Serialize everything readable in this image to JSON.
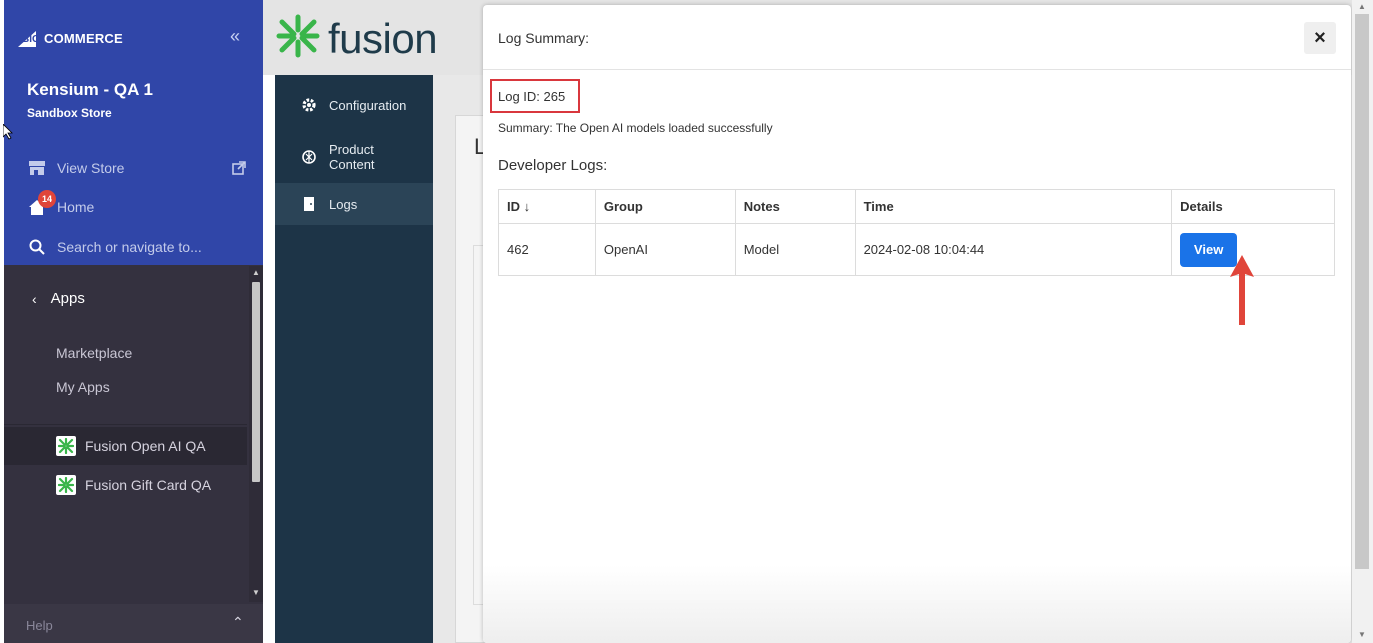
{
  "bigcommerce": {
    "brand": "BIGCOMMERCE",
    "brand_big": "BIG",
    "brand_rest": "COMMERCE",
    "store_name": "Kensium - QA 1",
    "store_type": "Sandbox Store",
    "nav": {
      "view_store": "View Store",
      "home": "Home",
      "home_badge": "14",
      "search_placeholder": "Search or navigate to..."
    },
    "apps": {
      "title": "Apps",
      "marketplace": "Marketplace",
      "my_apps": "My Apps",
      "installed": [
        {
          "label": "Fusion Open AI QA",
          "active": true
        },
        {
          "label": "Fusion Gift Card QA",
          "active": false
        }
      ]
    },
    "help": "Help"
  },
  "fusion": {
    "logo_text": "fusion",
    "nav": [
      {
        "label": "Configuration",
        "icon": "gear-icon"
      },
      {
        "label": "Product Content",
        "line1": "Product",
        "line2": "Content",
        "icon": "openai-icon"
      },
      {
        "label": "Logs",
        "icon": "door-icon",
        "active": true
      }
    ],
    "background_heading_initial": "L"
  },
  "modal": {
    "title": "Log Summary:",
    "log_id": "Log ID: 265",
    "summary": "Summary: The Open AI models loaded successfully",
    "developer_logs_title": "Developer Logs:",
    "table": {
      "columns": [
        "ID ↓",
        "Group",
        "Notes",
        "Time",
        "Details"
      ],
      "rows": [
        {
          "id": "462",
          "group": "OpenAI",
          "notes": "Model",
          "time": "2024-02-08 10:04:44",
          "details": "View"
        }
      ]
    },
    "close": "×"
  },
  "colors": {
    "bc_blue": "#3046a8",
    "bc_dark": "#34313f",
    "fusion_nav": "#1d3447",
    "fusion_green": "#39b54a",
    "highlight_red": "#d9373d",
    "button_blue": "#1a73e8"
  }
}
